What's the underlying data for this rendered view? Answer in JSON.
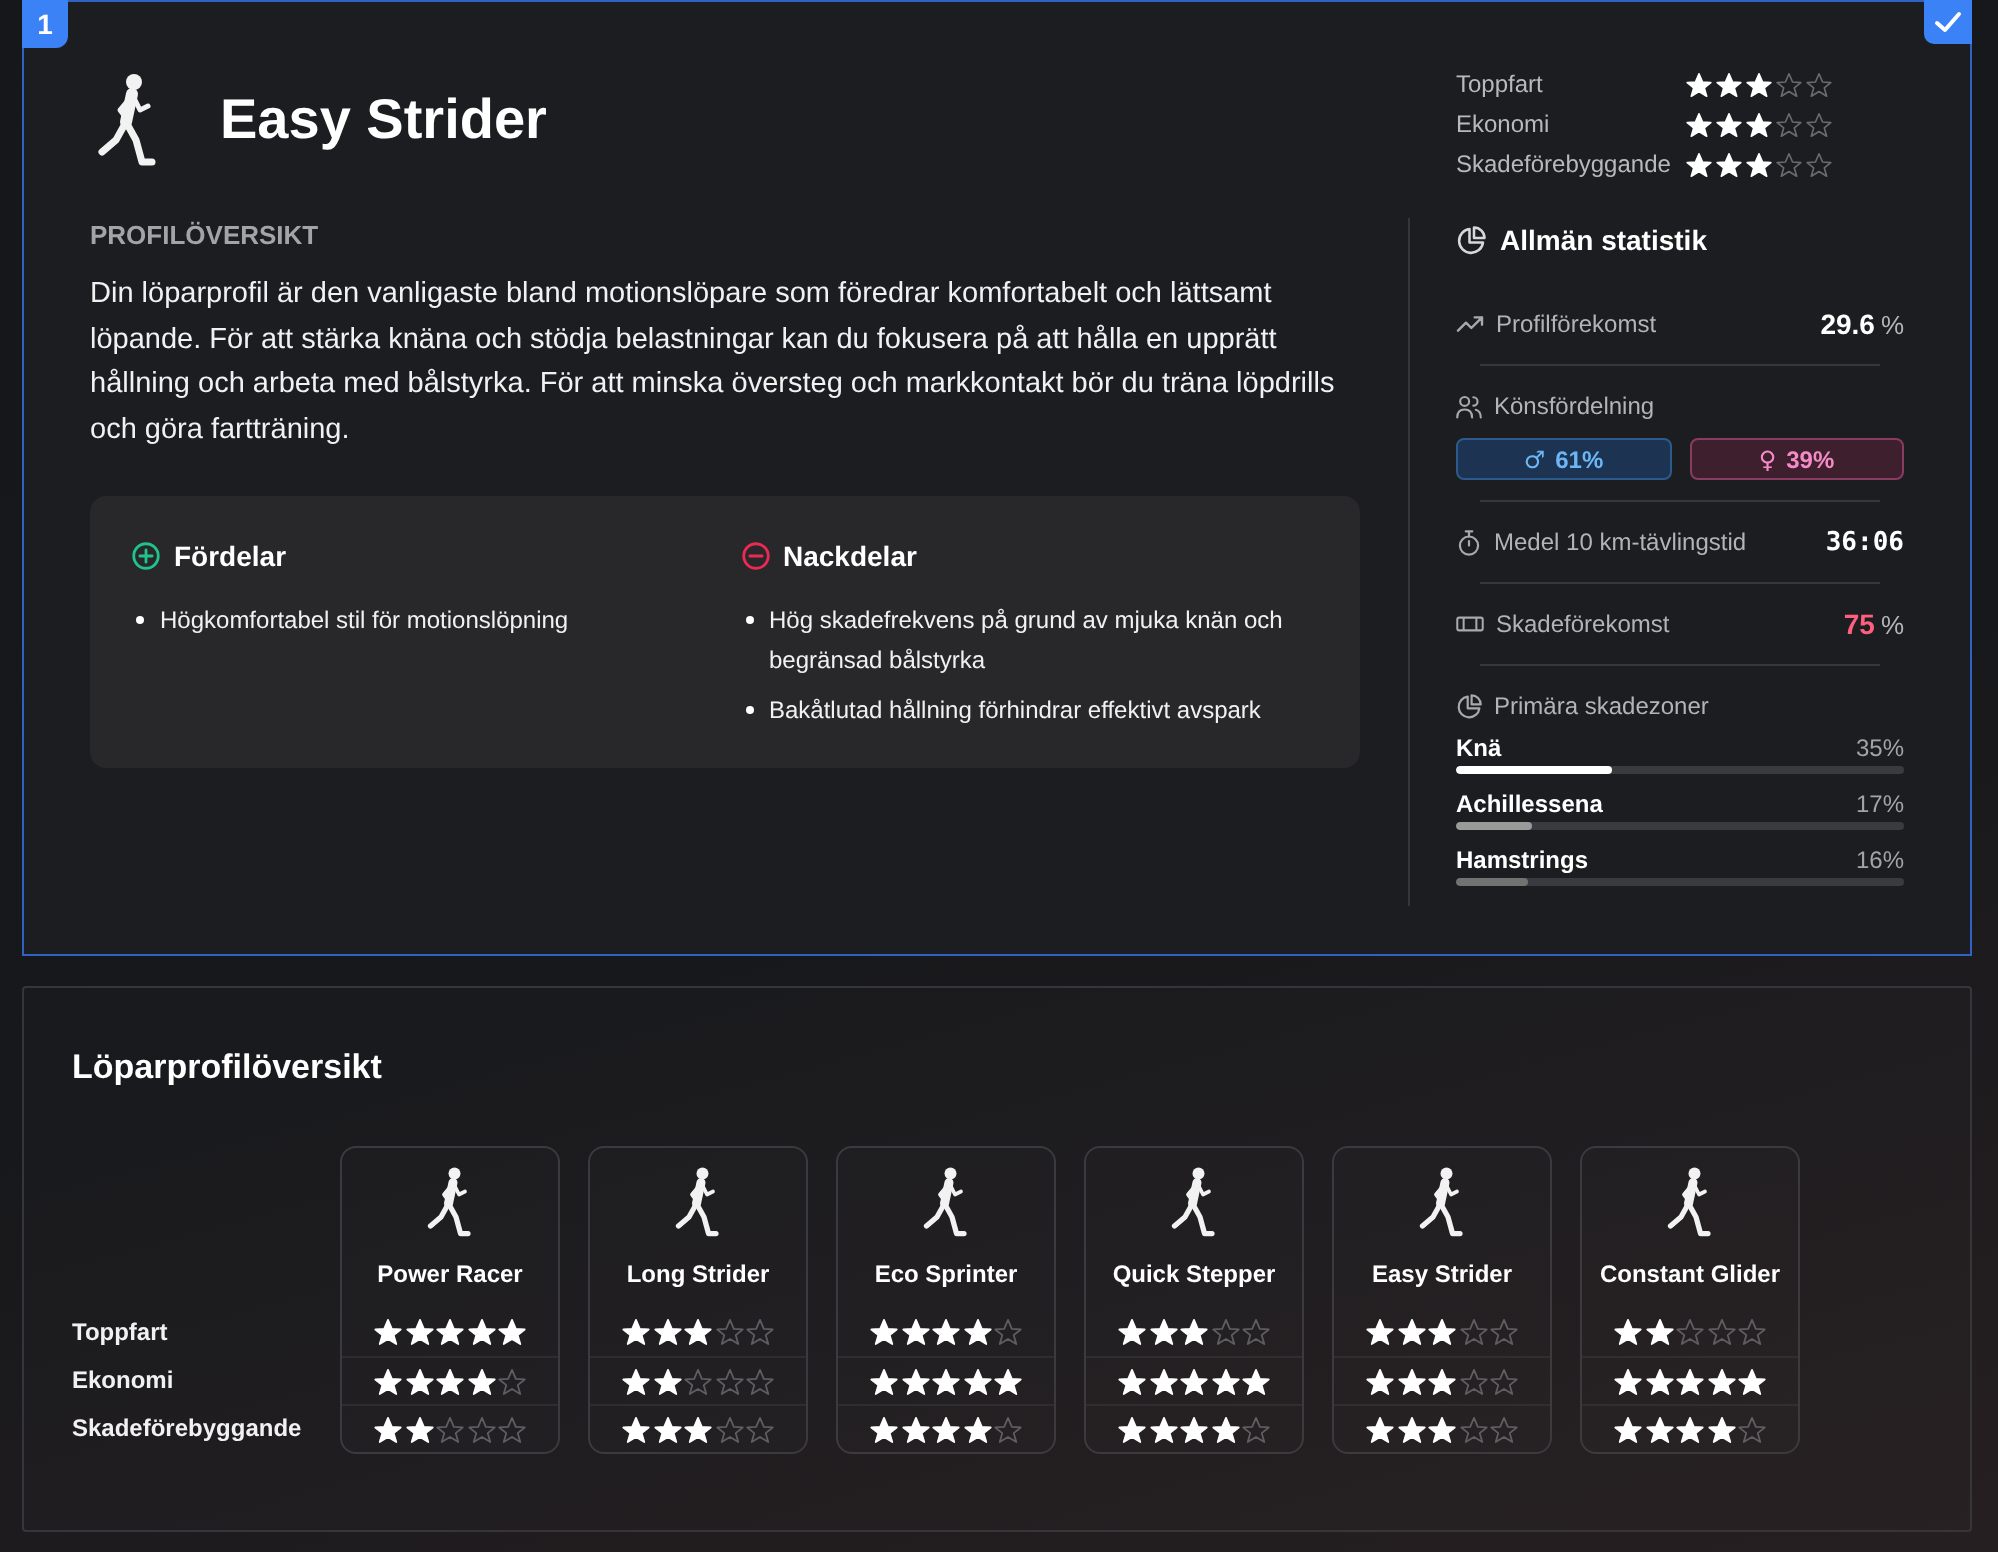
{
  "profile": {
    "badge": "1",
    "selected": true,
    "title": "Easy Strider",
    "ratings": [
      {
        "label": "Toppfart",
        "stars": 3
      },
      {
        "label": "Ekonomi",
        "stars": 3
      },
      {
        "label": "Skadeförebyggande",
        "stars": 3
      }
    ],
    "overview": {
      "heading": "PROFILÖVERSIKT",
      "text": "Din löparprofil är den vanligaste bland motionslöpare som föredrar komfortabelt och lättsamt löpande. För att stärka knäna och stödja belastningar kan du fokusera på att hålla en upprätt hållning och arbeta med bålstyrka. För att minska översteg och markkontakt bör du träna löpdrills och göra fartträning."
    },
    "pros_cons": [
      {
        "kind": "pros",
        "heading": "Fördelar",
        "items": [
          "Högkomfortabel stil för motionslöpning"
        ]
      },
      {
        "kind": "cons",
        "heading": "Nackdelar",
        "items": [
          "Hög skadefrekvens på grund av mjuka knän och begränsad bålstyrka",
          "Bakåtlutad hållning förhindrar effektivt avspark"
        ]
      }
    ],
    "stats": {
      "heading": "Allmän statistik",
      "rows": [
        {
          "kind": "prevalence",
          "label": "Profilförekomst",
          "value": "29.6",
          "unit": "%"
        },
        {
          "kind": "gender",
          "label": "Könsfördelning",
          "shares": [
            {
              "kind": "male",
              "symbol": "♂",
              "value": "61%"
            },
            {
              "kind": "female",
              "symbol": "♀",
              "value": "39%"
            }
          ]
        },
        {
          "kind": "race_time",
          "label": "Medel 10 km-tävlingstid",
          "value": "36:06"
        },
        {
          "kind": "injury_rate",
          "label": "Skadeförekomst",
          "value": "75",
          "unit": "%"
        },
        {
          "kind": "injury_zones",
          "label": "Primära skadezoner",
          "zones": [
            {
              "name": "Knä",
              "reading": "35%",
              "level": 0.35
            },
            {
              "name": "Achillessena",
              "reading": "17%",
              "level": 0.17
            },
            {
              "name": "Hamstrings",
              "reading": "16%",
              "level": 0.16
            }
          ]
        }
      ]
    }
  },
  "comparison": {
    "title": "Löparprofilöversikt",
    "criteria": [
      "Toppfart",
      "Ekonomi",
      "Skadeförebyggande"
    ],
    "profiles": [
      {
        "name": "Power Racer",
        "ratings": [
          {
            "stars": 5
          },
          {
            "stars": 4
          },
          {
            "stars": 2
          }
        ]
      },
      {
        "name": "Long Strider",
        "ratings": [
          {
            "stars": 3
          },
          {
            "stars": 2
          },
          {
            "stars": 3
          }
        ]
      },
      {
        "name": "Eco Sprinter",
        "ratings": [
          {
            "stars": 4
          },
          {
            "stars": 5
          },
          {
            "stars": 4
          }
        ]
      },
      {
        "name": "Quick Stepper",
        "ratings": [
          {
            "stars": 3
          },
          {
            "stars": 5
          },
          {
            "stars": 4
          }
        ]
      },
      {
        "name": "Easy Strider",
        "ratings": [
          {
            "stars": 3
          },
          {
            "stars": 3
          },
          {
            "stars": 3
          }
        ]
      },
      {
        "name": "Constant Glider",
        "ratings": [
          {
            "stars": 2
          },
          {
            "stars": 5
          },
          {
            "stars": 4
          }
        ]
      }
    ]
  }
}
